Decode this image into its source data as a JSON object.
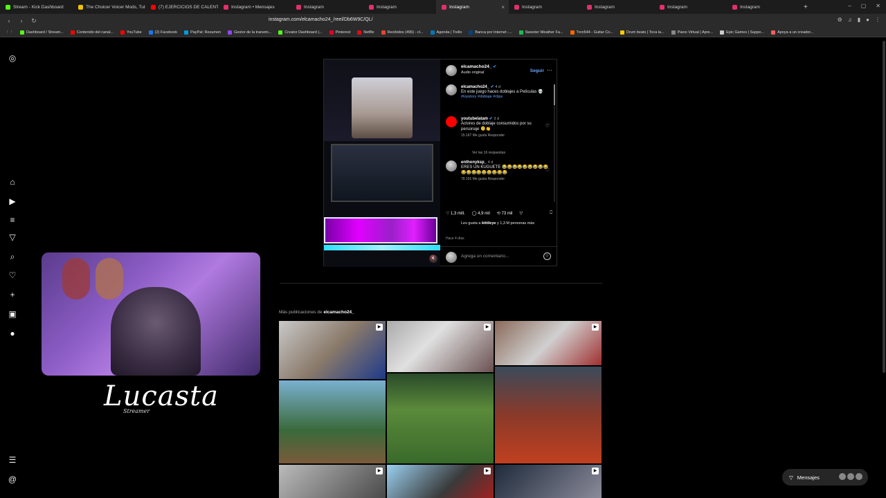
{
  "browser": {
    "tabs": [
      {
        "label": "Stream - Kick Dashboard",
        "color": "#53fc18",
        "active": false
      },
      {
        "label": "The Choicer Voicer Mods, Tut",
        "color": "#f2c200",
        "active": false
      },
      {
        "label": "(7) EJERCICIOS DE CALENTAM",
        "color": "#ff0000",
        "active": false
      },
      {
        "label": "Instagram • Mensajes",
        "color": "#e1306c",
        "active": false
      },
      {
        "label": "Instagram",
        "color": "#e1306c",
        "active": false
      },
      {
        "label": "Instagram",
        "color": "#e1306c",
        "active": false
      },
      {
        "label": "Instagram",
        "color": "#e1306c",
        "active": true
      },
      {
        "label": "Instagram",
        "color": "#e1306c",
        "active": false
      },
      {
        "label": "Instagram",
        "color": "#e1306c",
        "active": false
      },
      {
        "label": "Instagram",
        "color": "#e1306c",
        "active": false
      },
      {
        "label": "Instagram",
        "color": "#e1306c",
        "active": false
      }
    ],
    "url": "instagram.com/elcamacho24_/reel/Db6W9C/QL/",
    "bookmarks": [
      {
        "label": "Dashboard / Stream...",
        "color": "#53fc18"
      },
      {
        "label": "Contenido del canal...",
        "color": "#ff0000"
      },
      {
        "label": "YouTube",
        "color": "#ff0000"
      },
      {
        "label": "(2) Facebook",
        "color": "#1877f2"
      },
      {
        "label": "PayPal: Resumen",
        "color": "#009cde"
      },
      {
        "label": "Gestor de la transmi...",
        "color": "#9146ff"
      },
      {
        "label": "Creator Dashboard |...",
        "color": "#53fc18"
      },
      {
        "label": "Pinterest",
        "color": "#e60023"
      },
      {
        "label": "Netflix",
        "color": "#e50914"
      },
      {
        "label": "Recibidos (495) - cl...",
        "color": "#ea4335"
      },
      {
        "label": "Agenda | Trello",
        "color": "#0079bf"
      },
      {
        "label": "Banca por Internet -...",
        "color": "#004481"
      },
      {
        "label": "Sweeter Weather Fa...",
        "color": "#1db954"
      },
      {
        "label": "Tron544 - Guitar Co...",
        "color": "#ff6600"
      },
      {
        "label": "Drum beats | Toca la...",
        "color": "#ffcc00"
      },
      {
        "label": "Piano Virtual | Apre...",
        "color": "#888888"
      },
      {
        "label": "Epic Games | Suppo...",
        "color": "#cccccc"
      },
      {
        "label": "Apoya a un creador...",
        "color": "#ff5e5b"
      }
    ]
  },
  "stream_overlay": {
    "logo_text": "Lucasta",
    "logo_sub": "Streamer"
  },
  "reel": {
    "username": "elcamacho24_",
    "audio": "Audio original",
    "follow": "Seguir",
    "comments": [
      {
        "user": "elcamacho24_",
        "time": "4 d",
        "text": "En este juego haces doblajes a Películas 💀",
        "tags": "#toystory #doblaje #clips",
        "meta": ""
      },
      {
        "user": "youtubelatam",
        "time": "3 d",
        "text": "Actores de doblaje consumidos por su personaje 🫠👏",
        "tags": "",
        "meta": "15.167 Me gusta    Responder"
      },
      {
        "user": "enthonyksp_",
        "time": "4 d",
        "text": "ERES UN KUGUETE 😂😂😂😂😂😂😂😂😂😂😂😂😂😂😂😂😂😂",
        "tags": "",
        "meta": "78.191 Me gusta    Responder"
      }
    ],
    "view_replies": "Ver las 16 respuestas",
    "likes_count": "1,3 mill.",
    "comments_count": "4,9 mil",
    "shares_count": "73 mil",
    "liked_by_prefix": "Les gusta a",
    "liked_by_user": "kittileye",
    "liked_by_suffix": "y 1,3 M personas más",
    "ago": "Hace 4 días",
    "add_comment": "Agrega un comentario..."
  },
  "more_posts": {
    "label_prefix": "Más publicaciones de",
    "label_user": "elcamacho24_"
  },
  "messages": {
    "label": "Mensajes"
  }
}
